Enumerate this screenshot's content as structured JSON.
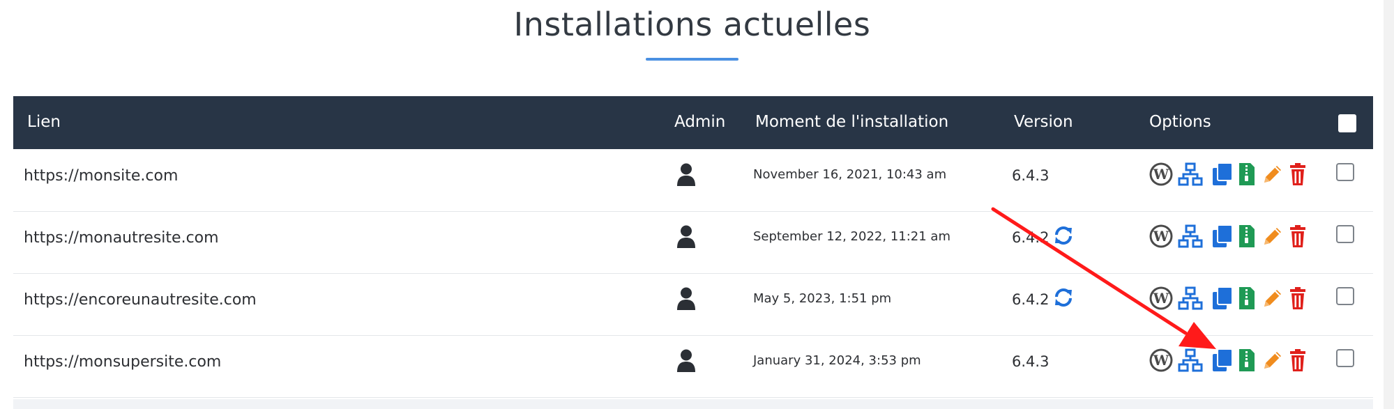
{
  "page": {
    "title": "Installations actuelles",
    "accent_color": "#4a90e2",
    "header_bg": "#283546"
  },
  "table": {
    "headers": {
      "link": "Lien",
      "admin": "Admin",
      "install_time": "Moment de l'installation",
      "version": "Version",
      "options": "Options"
    },
    "rows": [
      {
        "link": "https://monsite.com",
        "date": "November 16, 2021, 10:43 am",
        "version": "6.4.3",
        "update_available": false
      },
      {
        "link": "https://monautresite.com",
        "date": "September 12, 2022, 11:21 am",
        "version": "6.4.2",
        "update_available": true
      },
      {
        "link": "https://encoreunautresite.com",
        "date": "May 5, 2023, 1:51 pm",
        "version": "6.4.2",
        "update_available": true
      },
      {
        "link": "https://monsupersite.com",
        "date": "January 31, 2024, 3:53 pm",
        "version": "6.4.3",
        "update_available": false
      }
    ],
    "option_icons": [
      "wordpress-icon",
      "staging-network-icon",
      "clone-copy-icon",
      "backup-zip-icon",
      "edit-pencil-icon",
      "delete-trash-icon"
    ],
    "icon_colors": {
      "wordpress": "#4a4a4a",
      "network": "#1e6fd9",
      "copy": "#1e6fd9",
      "zip": "#1f9a55",
      "pencil": "#f08c1e",
      "trash": "#e0201b",
      "update": "#1e6fd9",
      "arrow": "#ff1a1a"
    }
  }
}
